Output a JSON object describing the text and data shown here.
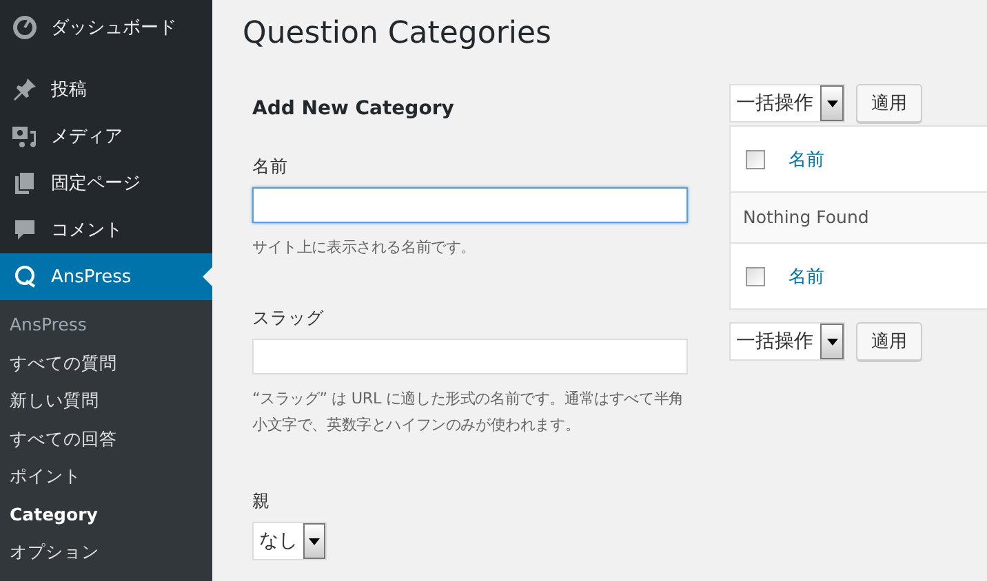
{
  "sidebar": {
    "items": [
      {
        "label": "ダッシュボード",
        "kind": "gauge",
        "selected": false
      },
      {
        "label": "投稿",
        "kind": "pin",
        "selected": false
      },
      {
        "label": "メディア",
        "kind": "media",
        "selected": false
      },
      {
        "label": "固定ページ",
        "kind": "pages",
        "selected": false
      },
      {
        "label": "コメント",
        "kind": "bubble",
        "selected": false
      },
      {
        "label": "AnsPress",
        "kind": "q",
        "selected": true
      }
    ],
    "submenu": [
      {
        "label": "AnsPress",
        "kind": "heading",
        "selected": false
      },
      {
        "label": "すべての質問",
        "kind": "link",
        "selected": false
      },
      {
        "label": "新しい質問",
        "kind": "link",
        "selected": false
      },
      {
        "label": "すべての回答",
        "kind": "link",
        "selected": false
      },
      {
        "label": "ポイント",
        "kind": "link",
        "selected": false
      },
      {
        "label": "Category",
        "kind": "link",
        "selected": true
      },
      {
        "label": "オプション",
        "kind": "link",
        "selected": false
      }
    ]
  },
  "page_title": "Question Categories",
  "form": {
    "heading": "Add New Category",
    "fields": [
      {
        "kind": "text",
        "label": "名前",
        "description": "サイト上に表示される名前です。",
        "focused": true
      },
      {
        "kind": "text",
        "label": "スラッグ",
        "description": "“スラッグ” は URL に適した形式の名前です。通常はすべて半角小文字で、英数字とハイフンのみが使われます。",
        "focused": false
      },
      {
        "kind": "select",
        "label": "親",
        "value": "なし"
      }
    ]
  },
  "table": {
    "bulk_action": "一括操作",
    "apply": "適用",
    "header": {
      "checked": false,
      "label": "名前"
    },
    "empty": "Nothing Found",
    "footer": {
      "checked": false,
      "label": "名前"
    },
    "bulk_action_bottom": "一括操作",
    "apply_bottom": "適用"
  }
}
